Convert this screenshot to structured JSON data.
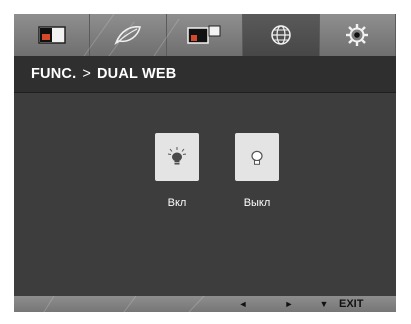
{
  "tabs": [
    {
      "icon": "picture-icon",
      "active": false
    },
    {
      "icon": "leaf-icon",
      "active": false
    },
    {
      "icon": "display-icon",
      "active": false
    },
    {
      "icon": "globe-icon",
      "active": true
    },
    {
      "icon": "gear-icon",
      "active": false
    }
  ],
  "header": {
    "section": "FUNC.",
    "separator": ">",
    "page": "DUAL WEB"
  },
  "options": [
    {
      "label": "Вкл",
      "icon": "bulb-on-icon"
    },
    {
      "label": "Выкл",
      "icon": "bulb-off-icon"
    }
  ],
  "footer": {
    "left_arrow": "◄",
    "right_arrow": "►",
    "down_arrow": "▼",
    "exit_label": "EXIT"
  },
  "colors": {
    "panel": "#3b3b3b",
    "tabbar": "#7f7f7f",
    "active_tab": "#4d4d4d",
    "option_box": "#e4e4e4"
  }
}
